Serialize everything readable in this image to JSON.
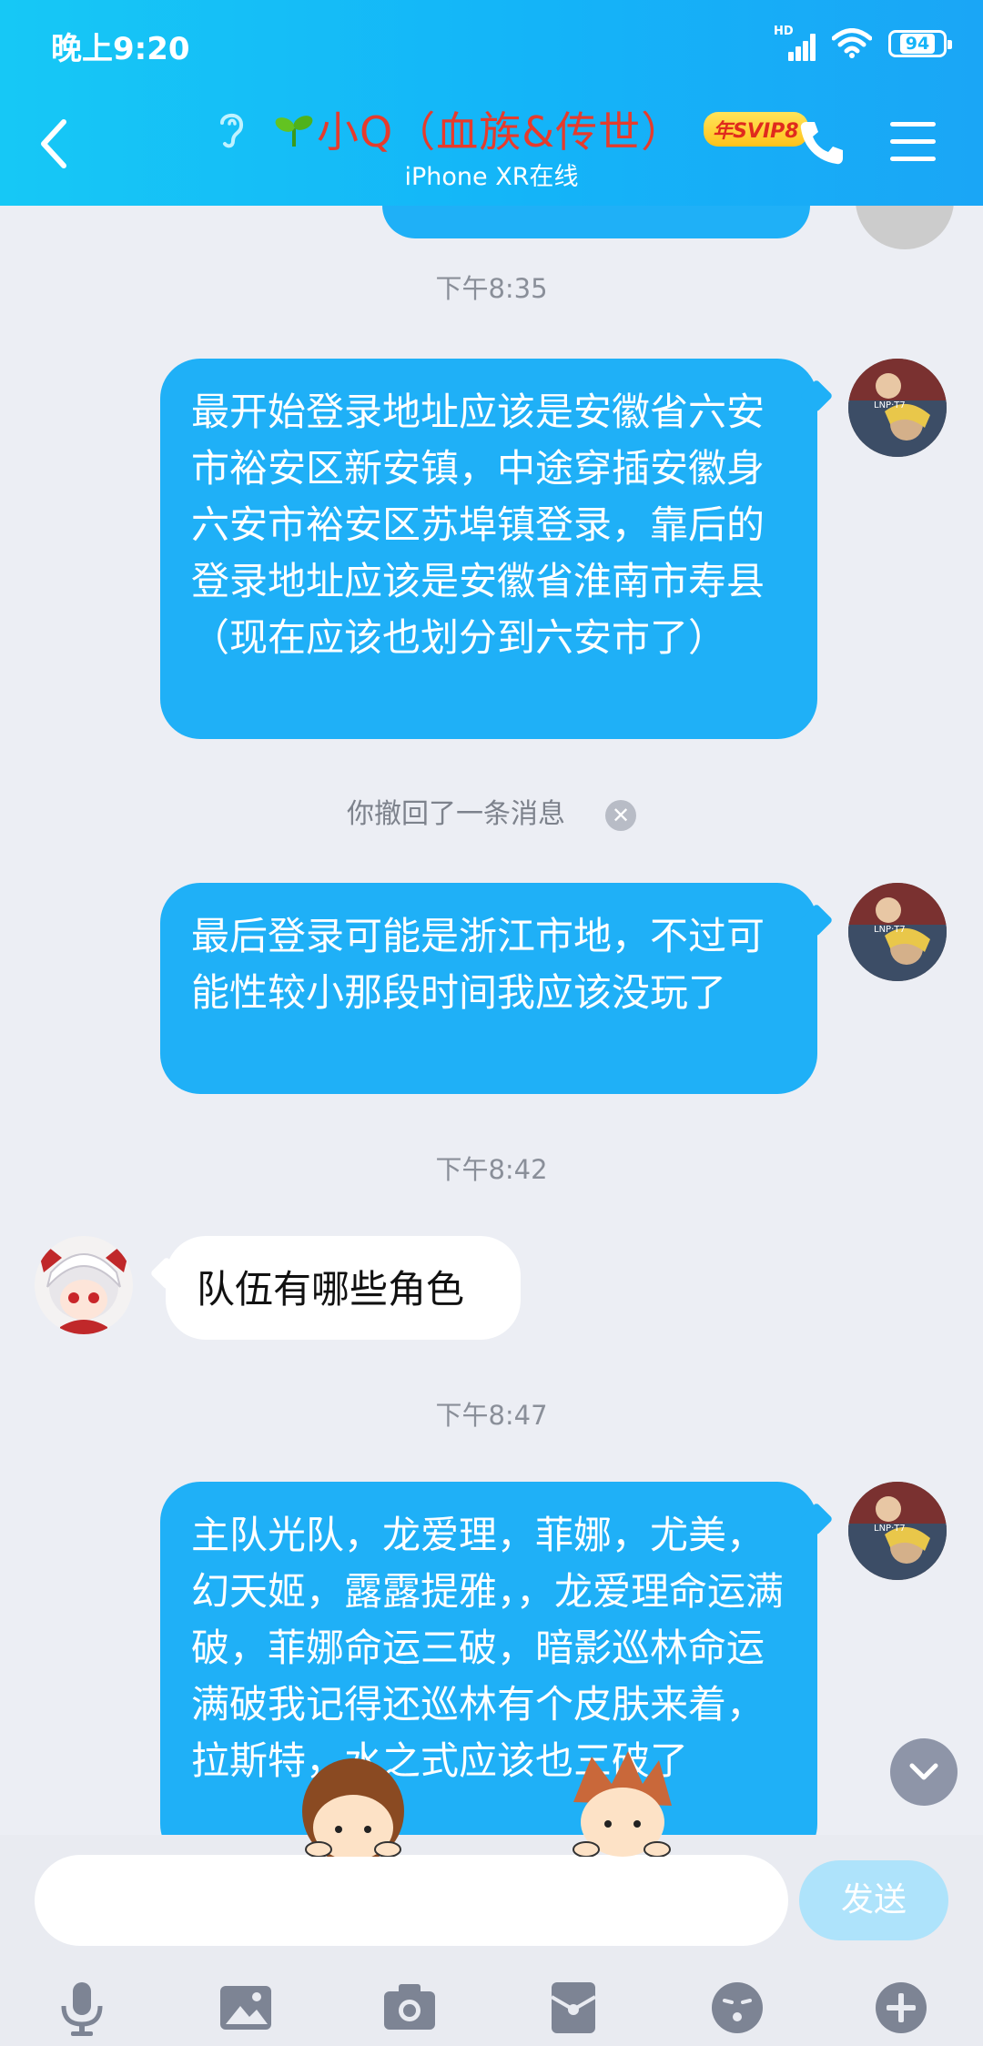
{
  "status_bar": {
    "time": "晚上9:20",
    "network": "HD",
    "battery": "94"
  },
  "header": {
    "contact_name": "小Q（血族&传世）",
    "badge": "年SVIP8",
    "device_status": "iPhone XR在线"
  },
  "messages": [
    {
      "type": "timestamp",
      "text": "下午8:35"
    },
    {
      "type": "outgoing",
      "text": "最开始登录地址应该是安徽省六安市裕安区新安镇，中途穿插安徽身六安市裕安区苏埠镇登录，靠后的登录地址应该是安徽省淮南市寿县（现在应该也划分到六安市了）"
    },
    {
      "type": "recall",
      "text": "你撤回了一条消息"
    },
    {
      "type": "outgoing",
      "text": "最后登录可能是浙江市地，不过可能性较小那段时间我应该没玩了"
    },
    {
      "type": "timestamp",
      "text": "下午8:42"
    },
    {
      "type": "incoming",
      "text": "队伍有哪些角色"
    },
    {
      "type": "timestamp",
      "text": "下午8:47"
    },
    {
      "type": "outgoing",
      "text": "主队光队，龙爱理，菲娜，尤美，幻天姬，露露提雅，，龙爱理命运满破，菲娜命运三破，暗影巡林命运满破我记得还巡林有个皮肤来着，拉斯特，水之式应该也三破了"
    }
  ],
  "input": {
    "placeholder": "",
    "send_label": "发送"
  },
  "toolbar_icons": [
    "microphone-icon",
    "image-icon",
    "camera-icon",
    "red-packet-icon",
    "emoji-icon",
    "plus-icon"
  ],
  "colors": {
    "header": "#14b4f8",
    "bubble_out": "#1fb0f7",
    "bubble_in": "#ffffff",
    "name": "#e63b2c",
    "background": "#eceef4"
  }
}
